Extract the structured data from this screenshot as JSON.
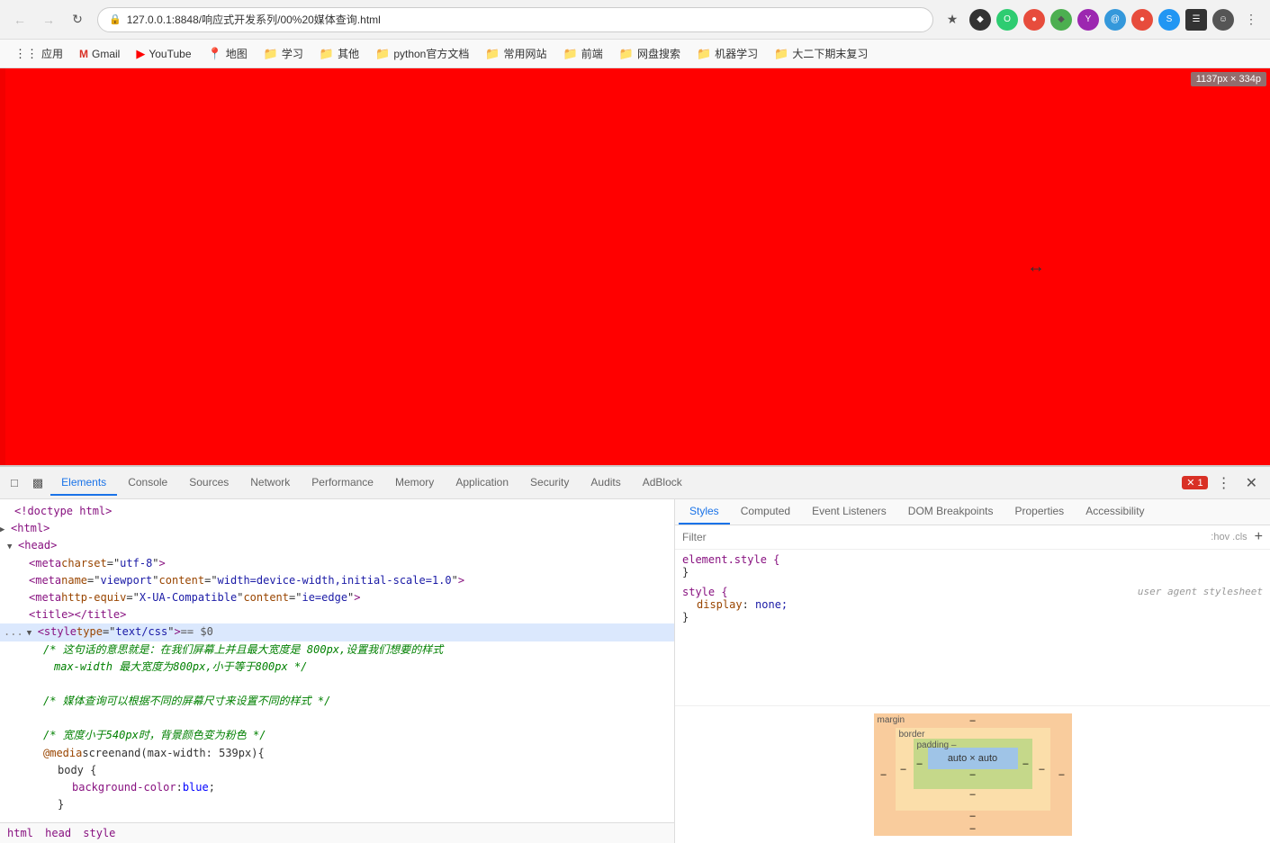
{
  "browser": {
    "url": "127.0.0.1:8848/响应式开发系列/00%20媒体查询.html",
    "viewport_size": "1137px × 334p",
    "nav": {
      "back_disabled": true,
      "forward_disabled": true
    }
  },
  "bookmarks": [
    {
      "label": "应用",
      "icon": "⊞"
    },
    {
      "label": "Gmail",
      "icon": "M"
    },
    {
      "label": "YouTube",
      "icon": "▶"
    },
    {
      "label": "地图",
      "icon": "📍"
    },
    {
      "label": "学习",
      "icon": "📁"
    },
    {
      "label": "其他",
      "icon": "📁"
    },
    {
      "label": "python官方文档",
      "icon": "📁"
    },
    {
      "label": "常用网站",
      "icon": "📁"
    },
    {
      "label": "前端",
      "icon": "📁"
    },
    {
      "label": "网盘搜索",
      "icon": "📁"
    },
    {
      "label": "机器学习",
      "icon": "📁"
    },
    {
      "label": "大二下期末复习",
      "icon": "📁"
    }
  ],
  "devtools": {
    "tabs": [
      "Elements",
      "Console",
      "Sources",
      "Network",
      "Performance",
      "Memory",
      "Application",
      "Security",
      "Audits",
      "AdBlock"
    ],
    "active_tab": "Elements",
    "error_count": "1",
    "styles_tabs": [
      "Styles",
      "Computed",
      "Event Listeners",
      "DOM Breakpoints",
      "Properties",
      "Accessibility"
    ],
    "active_styles_tab": "Styles",
    "filter_placeholder": "Filter",
    "filter_hint": ":hov .cls",
    "style_blocks": [
      {
        "selector": "element.style {",
        "close": "}",
        "properties": []
      },
      {
        "selector": "style {",
        "source": "user agent stylesheet",
        "close": "}",
        "properties": [
          {
            "name": "display",
            "colon": ":",
            "value": "none;"
          }
        ]
      }
    ]
  },
  "elements_code": {
    "lines": [
      {
        "indent": 0,
        "html": "<!doctype html>",
        "type": "comment-tag"
      },
      {
        "indent": 0,
        "html": "<html>",
        "type": "tag",
        "triangle": "right"
      },
      {
        "indent": 0,
        "html": "<head>",
        "type": "tag",
        "triangle": "down",
        "selected": false
      },
      {
        "indent": 2,
        "html": "<meta charset=\"utf-8\">",
        "type": "tag"
      },
      {
        "indent": 2,
        "html": "<meta name=\"viewport\" content=\"width=device-width,initial-scale=1.0\">",
        "type": "tag"
      },
      {
        "indent": 2,
        "html": "<meta http-equiv=\"X-UA-Compatible\" content=\"ie=edge\">",
        "type": "tag"
      },
      {
        "indent": 2,
        "html": "<title></title>",
        "type": "tag"
      },
      {
        "indent": 0,
        "html": "<style type=\"text/css\"> == $0",
        "type": "tag-selected",
        "triangle": "down",
        "selected": true
      },
      {
        "indent": 4,
        "html": "/* 这句话的意思就是：在我们屏幕上并且最大宽度是 800px,设置我们想要的样式",
        "type": "comment"
      },
      {
        "indent": 5,
        "html": "max-width 最大宽度为800px,小于等于800px */",
        "type": "comment"
      },
      {
        "indent": 4,
        "html": "",
        "type": "empty"
      },
      {
        "indent": 4,
        "html": "/* 媒体查询可以根据不同的屏幕尺寸来设置不同的样式 */",
        "type": "comment"
      },
      {
        "indent": 4,
        "html": "",
        "type": "empty"
      },
      {
        "indent": 4,
        "html": "/* 宽度小于540px时，背景颜色变为粉色 */",
        "type": "comment"
      },
      {
        "indent": 4,
        "html": "@media screen and (max-width: 539px){",
        "type": "code"
      },
      {
        "indent": 8,
        "html": "body {",
        "type": "code"
      },
      {
        "indent": 12,
        "html": "background-color: blue;",
        "type": "code-blue"
      },
      {
        "indent": 8,
        "html": "}",
        "type": "code"
      }
    ]
  },
  "breadcrumb": [
    "html",
    "head",
    "style"
  ],
  "box_model": {
    "margin_label": "margin",
    "border_label": "border",
    "padding_label": "padding –",
    "content": "auto × auto",
    "top_dash": "–",
    "right_dash": "–",
    "bottom_dash": "–",
    "left_dash": "–",
    "margin_top": "–",
    "margin_right": "–",
    "margin_bottom": "–",
    "margin_left": "–",
    "border_top": "–",
    "border_right": "–",
    "border_bottom": "–",
    "border_left": "–",
    "padding_top": "–",
    "padding_right": "–",
    "padding_bottom": "–",
    "padding_left": "–"
  }
}
